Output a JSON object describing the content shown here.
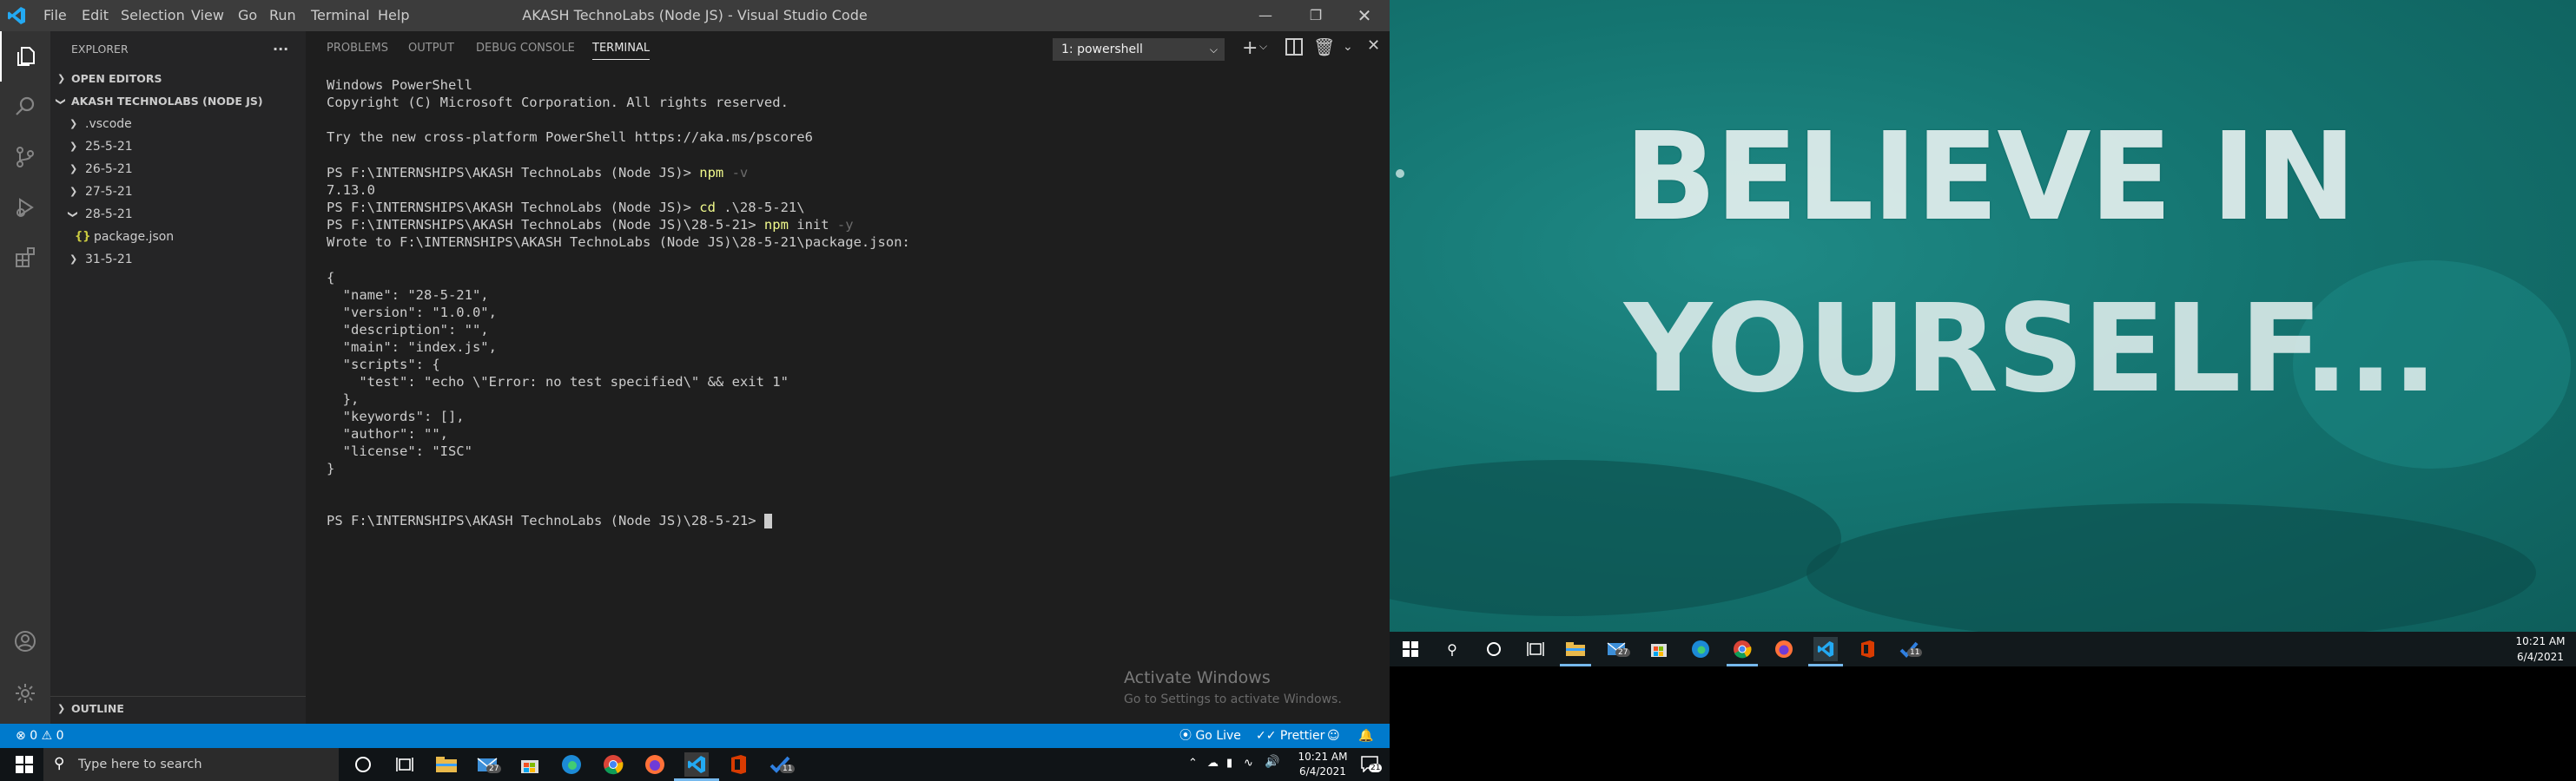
{
  "window": {
    "title": "AKASH TechnoLabs (Node JS) - Visual Studio Code",
    "menu": [
      "File",
      "Edit",
      "Selection",
      "View",
      "Go",
      "Run",
      "Terminal",
      "Help"
    ]
  },
  "sidebar": {
    "header": "EXPLORER",
    "more": "···",
    "open_editors": "OPEN EDITORS",
    "root": "AKASH TECHNOLABS (NODE JS)",
    "items": [
      {
        "label": ".vscode"
      },
      {
        "label": "25-5-21"
      },
      {
        "label": "26-5-21"
      },
      {
        "label": "27-5-21"
      },
      {
        "label": "28-5-21"
      },
      {
        "label": "package.json",
        "icon": "{}"
      },
      {
        "label": "31-5-21"
      }
    ],
    "outline": "OUTLINE"
  },
  "panel": {
    "tabs": [
      "PROBLEMS",
      "OUTPUT",
      "DEBUG CONSOLE",
      "TERMINAL"
    ],
    "terminal_select": "1: powershell"
  },
  "terminal": {
    "l1": "Windows PowerShell",
    "l2": "Copyright (C) Microsoft Corporation. All rights reserved.",
    "l3": "Try the new cross-platform PowerShell https://aka.ms/pscore6",
    "p1": "PS F:\\INTERNSHIPS\\AKASH TechnoLabs (Node JS)> ",
    "p1_cmd": "npm",
    "p1_arg": " -v",
    "out1": "7.13.0",
    "p2": "PS F:\\INTERNSHIPS\\AKASH TechnoLabs (Node JS)> ",
    "p2_cmd": "cd",
    "p2_rest": " .\\28-5-21\\",
    "p3": "PS F:\\INTERNSHIPS\\AKASH TechnoLabs (Node JS)\\28-5-21> ",
    "p3_cmd": "npm",
    "p3_rest": " init ",
    "p3_arg": "-y",
    "wrote": "Wrote to F:\\INTERNSHIPS\\AKASH TechnoLabs (Node JS)\\28-5-21\\package.json:",
    "json": [
      "{",
      "  \"name\": \"28-5-21\",",
      "  \"version\": \"1.0.0\",",
      "  \"description\": \"\",",
      "  \"main\": \"index.js\",",
      "  \"scripts\": {",
      "    \"test\": \"echo \\\"Error: no test specified\\\" && exit 1\"",
      "  },",
      "  \"keywords\": [],",
      "  \"author\": \"\",",
      "  \"license\": \"ISC\"",
      "}"
    ],
    "final_prompt": "PS F:\\INTERNSHIPS\\AKASH TechnoLabs (Node JS)\\28-5-21> "
  },
  "activate": {
    "title": "Activate Windows",
    "sub": "Go to Settings to activate Windows."
  },
  "status": {
    "errors": "0",
    "warnings": "0",
    "go_live": "Go Live",
    "prettier": "Prettier"
  },
  "taskbar_left": {
    "search_placeholder": "Type here to search",
    "mail_badge": "27",
    "todo_badge": "11",
    "time": "10:21 AM",
    "date": "6/4/2021",
    "notif_badge": "21"
  },
  "wallpaper": {
    "line1": "BELIEVE IN",
    "line2": "YOURSELF..."
  },
  "taskbar_right": {
    "mail_badge": "27",
    "todo_badge": "11",
    "time": "10:21 AM",
    "date": "6/4/2021"
  },
  "colors": {
    "accent": "#007acc",
    "titlebar": "#3c3c3c",
    "activity": "#333333",
    "sidebar": "#252526",
    "editor": "#1e1e1e",
    "wallpaper": "#147470"
  }
}
